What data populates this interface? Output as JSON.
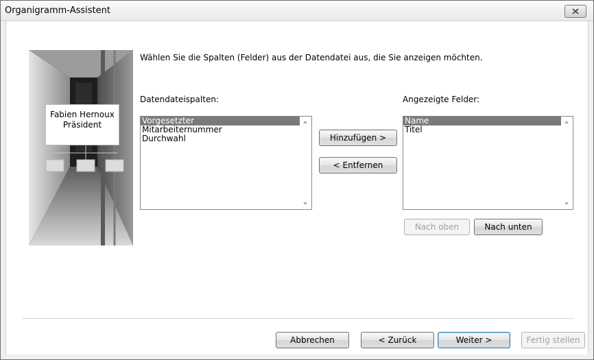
{
  "window": {
    "title": "Organigramm-Assistent"
  },
  "illustration": {
    "name": "Fabien Hernoux",
    "role": "Präsident"
  },
  "instruction": "Wählen Sie die Spalten (Felder) aus der Datendatei aus, die Sie anzeigen möchten.",
  "source": {
    "label": "Datendateispalten:",
    "items": [
      {
        "label": "Vorgesetzter",
        "selected": true
      },
      {
        "label": "Mitarbeiternummer",
        "selected": false
      },
      {
        "label": "Durchwahl",
        "selected": false
      }
    ]
  },
  "target": {
    "label": "Angezeigte Felder:",
    "items": [
      {
        "label": "Name",
        "selected": true
      },
      {
        "label": "Titel",
        "selected": false
      }
    ]
  },
  "buttons": {
    "add": "Hinzufügen >",
    "remove": "< Entfernen",
    "move_up": "Nach oben",
    "move_down": "Nach unten",
    "cancel": "Abbrechen",
    "back": "< Zurück",
    "next": "Weiter >",
    "finish": "Fertig stellen"
  },
  "colors": {
    "selection": "#7a7a7a",
    "default_button_border": "#3c7fb1"
  }
}
